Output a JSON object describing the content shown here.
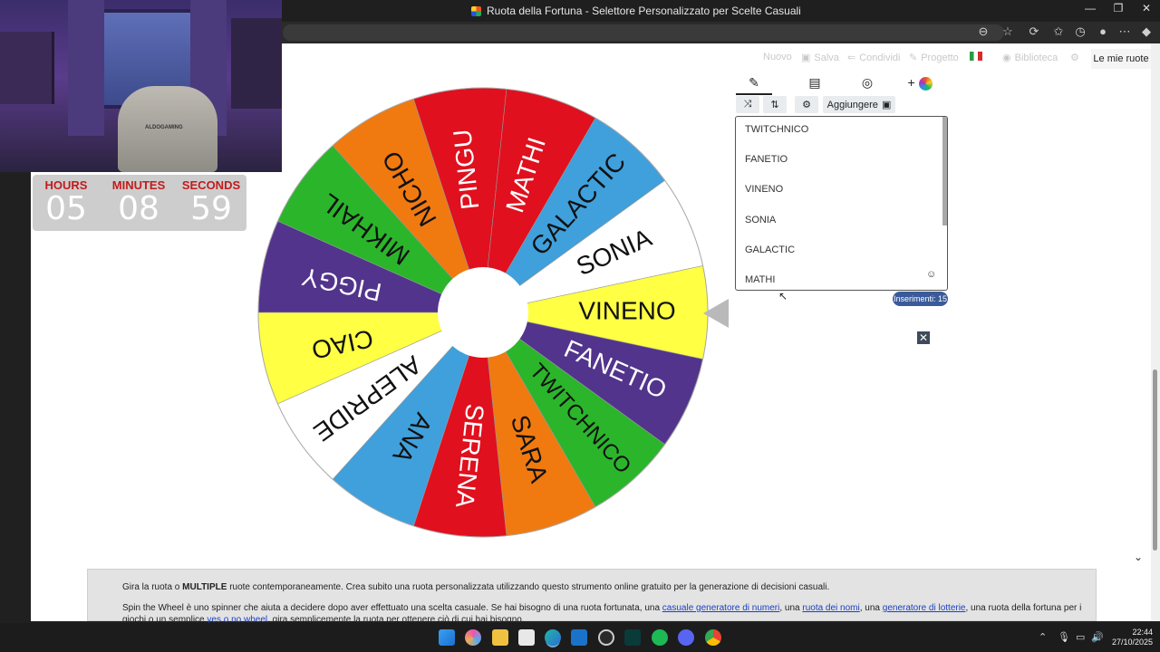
{
  "window": {
    "title": "Ruota della Fortuna - Selettore Personalizzato per Scelte Casuali"
  },
  "timer": {
    "hours_label": "HOURS",
    "minutes_label": "MINUTES",
    "seconds_label": "SECONDS",
    "hours": "05",
    "minutes": "08",
    "seconds": "59"
  },
  "webcam": {
    "chair_text": "ALDOGAMING"
  },
  "toolbar": {
    "new": "Nuovo",
    "save": "Salva",
    "share": "Condividi",
    "project": "Progetto",
    "library": "Biblioteca",
    "my_wheels": "Le mie ruote"
  },
  "editor": {
    "add_label": "Aggiungere",
    "entries": [
      "TWITCHNICO",
      "FANETIO",
      "VINENO",
      "SONIA",
      "GALACTIC",
      "MATHI"
    ],
    "count_text": "Inserimenti: 15"
  },
  "wheel": {
    "segments": [
      {
        "label": "VINENO",
        "color": "#ffff44",
        "text": "#111111"
      },
      {
        "label": "FANETIO",
        "color": "#52348c",
        "text": "#ffffff"
      },
      {
        "label": "TWITCHNICO",
        "color": "#2bb52b",
        "text": "#111111"
      },
      {
        "label": "SARA",
        "color": "#f07a10",
        "text": "#111111"
      },
      {
        "label": "SERENA",
        "color": "#e0101e",
        "text": "#ffffff"
      },
      {
        "label": "ANA",
        "color": "#3fa0dc",
        "text": "#111111"
      },
      {
        "label": "ALEPRIDE",
        "color": "#ffffff",
        "text": "#111111"
      },
      {
        "label": "CIAO",
        "color": "#ffff44",
        "text": "#111111"
      },
      {
        "label": "PIGGY",
        "color": "#52348c",
        "text": "#ffffff"
      },
      {
        "label": "MIKHAIL",
        "color": "#2bb52b",
        "text": "#111111"
      },
      {
        "label": "NICHO",
        "color": "#f07a10",
        "text": "#111111"
      },
      {
        "label": "PINGU",
        "color": "#e0101e",
        "text": "#ffffff"
      },
      {
        "label": "MATHI",
        "color": "#e0101e",
        "text": "#ffffff"
      },
      {
        "label": "GALACTIC",
        "color": "#3fa0dc",
        "text": "#111111"
      },
      {
        "label": "SONIA",
        "color": "#ffffff",
        "text": "#111111"
      }
    ]
  },
  "description": {
    "p1_start": "Gira la ruota o ",
    "p1_bold": "MULTIPLE",
    "p1_end": " ruote contemporaneamente. Crea subito una ruota personalizzata utilizzando questo strumento online gratuito per la generazione di decisioni casuali.",
    "p2_a": "Spin the Wheel è uno spinner che aiuta a decidere dopo aver effettuato una scelta casuale. Se hai bisogno di una ruota fortunata, una ",
    "link1": "casuale generatore di numeri",
    "p2_b": ", una ",
    "link2": "ruota dei nomi",
    "p2_c": ", una ",
    "link3": "generatore di lotterie",
    "p2_d": ", una ruota della fortuna per i giochi o un semplice ",
    "link4": "yes o no wheel",
    "p2_e": ", gira semplicemente la ruota per ottenere ciò di cui hai bisogno."
  },
  "taskbar": {
    "time": "22:44",
    "date": "27/10/2025"
  },
  "colors": {
    "accent": "#3a5a9a",
    "timer_label": "#c21c1c"
  }
}
